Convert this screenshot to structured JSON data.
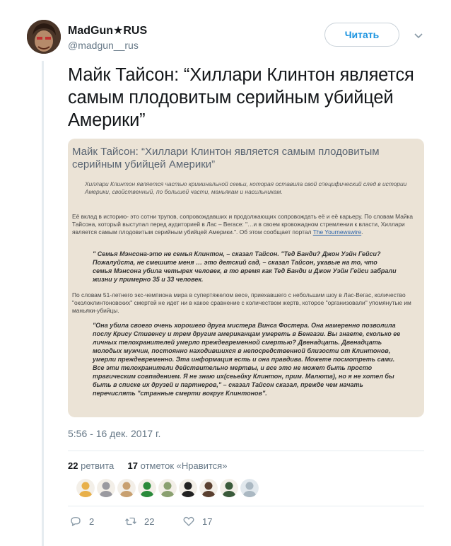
{
  "author": {
    "display_name": "MadGun★RUS",
    "handle": "@madgun__rus"
  },
  "follow_button": {
    "label": "Читать"
  },
  "tweet": {
    "text": "Майк Тайсон: “Хиллари Клинтон является самым плодовитым серийным убийцей Америки”",
    "timestamp": "5:56 - 16 дек. 2017 г."
  },
  "card": {
    "title": "Майк Тайсон: “Хиллари Клинтон является самым плодовитым серийным убийцей Америки”",
    "intro": "Хиллари Клинтон является частью криминальной семьи, которая оставила свой специфический след в истории Америки, свойственный, по большей части, маньякам и насильникам.",
    "p1": "Её вклад в историю- это сотни трупов, сопровождавших и продолжающих сопровождать её и её карьеру. По словам Майка Тайсона, который выступал перед аудиторией в Лас – Вегасе: \"…и в своем кровожадном стремлении к власти, Хиллари является самым плодовитым серийным убийцей Америки.\". Об этом сообщает портал",
    "p1_link": "The Yournewswire",
    "q1": "\" Семья Мэнсона-это не семья Клинтон, – сказал Тайсон. \"Тед Банди? Джон Уэйн Гейси? Пожалуйста, не смешите меня … это детский сад, – сказал Тайсон, укавые на то, что семья Мэнсона убила четырех человек, в то время как Тед Банди и Джон Уэйн Гейси забрали жизни у примерно 35 и 33 человек.",
    "p2": "По словам 51-летнего экс-чемпиона мира в супертяжелом весе, приехавшего с небольшим шоу в Лас-Вегас, количество \"околоклинтоновских\" смертей не идет ни в какое сравнение с количеством жертв, которое \"организовали\" упомянутые им маньяки-убийцы.",
    "q2": "\"Она убила своего очень хорошего друга мистера Винса Фостера. Она намеренно позволила послу Крису Стивенсу и трем другим американцам умереть в Бенгази. Вы знаете, сколько ее личных телохранителей умерло преждевременной смертью? Двенадцать. Двенадцать молодых мужчин, постоянно находившихся в непосредственной близости от Клинтонов, умерли преждевременно. Эта информация есть и она правдива. Можете посмотреть сами. Все эти телохранители действительно мертвы, и все это не может быть просто трагическим совпадением. Я не знаю их(сеьейку Клинтон, прим. Малюта), но я не хотел бы быть в списке их друзей и партнеров,\" – сказал Тайсон сказал, прежде чем начать перечислять \"странные смерти вокруг Клинтонов\"."
  },
  "stats": {
    "retweet_count": "22",
    "retweet_label": "ретвита",
    "like_count": "17",
    "like_label": "отметок «Нравится»"
  },
  "likers": [
    {
      "color": "#e8b04a"
    },
    {
      "color": "#9a9aa0"
    },
    {
      "color": "#c8a070"
    },
    {
      "color": "#2a8a3a"
    },
    {
      "color": "#8aa070"
    },
    {
      "color": "#222222"
    },
    {
      "color": "#5a4030"
    },
    {
      "color": "#3a5a3a"
    },
    {
      "color": "#aab8c2"
    }
  ],
  "actions": {
    "reply_count": "2",
    "retweet_count": "22",
    "like_count": "17"
  }
}
